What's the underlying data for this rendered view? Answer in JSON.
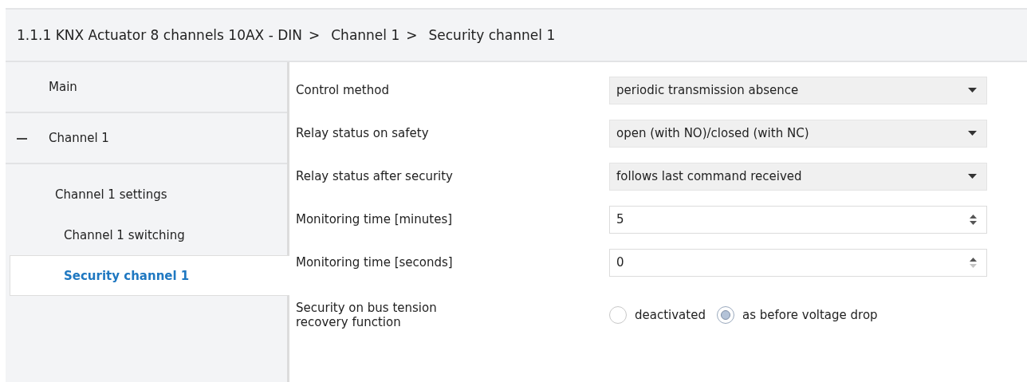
{
  "breadcrumb": {
    "separator": ">",
    "items": [
      "1.1.1 KNX Actuator 8 channels 10AX - DIN",
      "Channel 1",
      "Security channel 1"
    ]
  },
  "sidebar": {
    "items": [
      {
        "label": "Main",
        "selected": false
      },
      {
        "label": "Channel 1",
        "selected": false,
        "expanded": true,
        "children": [
          {
            "label": "Channel 1 settings",
            "selected": false,
            "children": [
              {
                "label": "Channel 1 switching",
                "selected": false
              },
              {
                "label": "Security channel 1",
                "selected": true
              }
            ]
          }
        ]
      }
    ]
  },
  "parameters": [
    {
      "kind": "dropdown",
      "label": "Control method",
      "value": "periodic transmission absence"
    },
    {
      "kind": "dropdown",
      "label": "Relay status on safety",
      "value": "open (with NO)/closed (with NC)"
    },
    {
      "kind": "dropdown",
      "label": "Relay status after security",
      "value": "follows last command received"
    },
    {
      "kind": "spin",
      "label": "Monitoring time [minutes]",
      "value": "5",
      "down_disabled": false
    },
    {
      "kind": "spin",
      "label": "Monitoring time [seconds]",
      "value": "0",
      "down_disabled": true
    },
    {
      "kind": "radio",
      "label": "Security on bus tension recovery function",
      "options": [
        {
          "label": "deactivated",
          "selected": false
        },
        {
          "label": "as before voltage drop",
          "selected": true
        }
      ]
    }
  ]
}
